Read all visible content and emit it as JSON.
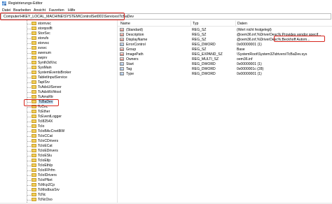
{
  "window": {
    "title": "Registrierungs-Editor",
    "icon": "regedit-icon"
  },
  "menu": [
    "Datei",
    "Bearbeiten",
    "Ansicht",
    "Favoriten",
    "Hilfe"
  ],
  "address": "Computer\\HKEY_LOCAL_MACHINE\\SYSTEM\\ControlSet001\\Services\\TcBaDev",
  "tree": {
    "items": [
      {
        "label": "stornvsc"
      },
      {
        "label": "storqosflt"
      },
      {
        "label": "StorSvc"
      },
      {
        "label": "storufs"
      },
      {
        "label": "storvsc"
      },
      {
        "label": "svsvc"
      },
      {
        "label": "swenum"
      },
      {
        "label": "swprv"
      },
      {
        "label": "Synth3dVsc"
      },
      {
        "label": "SysMain"
      },
      {
        "label": "SystemEventsBroker"
      },
      {
        "label": "TabletInputService"
      },
      {
        "label": "TapiSrv"
      },
      {
        "label": "TcAdsUiServer"
      },
      {
        "label": "TcAdsWcfHost"
      },
      {
        "label": "TcAmsRtr"
      },
      {
        "label": "TcBaDev",
        "selected": true
      },
      {
        "label": "TcCnc"
      },
      {
        "label": "TcEther"
      },
      {
        "label": "TcEventLogger"
      },
      {
        "label": "TcI8254X"
      },
      {
        "label": "TcIo"
      },
      {
        "label": "TcIoBAcCnet8iW"
      },
      {
        "label": "TcIoCCat"
      },
      {
        "label": "TcIoCDrivers"
      },
      {
        "label": "TcIoECat"
      },
      {
        "label": "TcIoEDrivers"
      },
      {
        "label": "TcIoESlu"
      },
      {
        "label": "TcIoEtlp"
      },
      {
        "label": "TcIoEthIp"
      },
      {
        "label": "TcIoIFPrfm"
      },
      {
        "label": "TcIoIDrivers"
      },
      {
        "label": "TcIoPNet"
      },
      {
        "label": "TcMcp2Cp"
      },
      {
        "label": "TcModbusSrv"
      },
      {
        "label": "TcNc"
      },
      {
        "label": "TcNcOso"
      }
    ]
  },
  "columns": {
    "name": "Name",
    "type": "Typ",
    "data": "Daten"
  },
  "values": [
    {
      "name": "(Standard)",
      "type": "REG_SZ",
      "data": "(Wert nicht festgelegt)",
      "kind": "ab"
    },
    {
      "name": "Description",
      "type": "REG_SZ",
      "data": "@oem36.inf,%DriverDesc%;Provides vendor specif...",
      "kind": "ab"
    },
    {
      "name": "DisplayName",
      "type": "REG_SZ",
      "data": "@oem36.inf,%DriverDesc%;Beckhoff Autom...",
      "kind": "ab"
    },
    {
      "name": "ErrorControl",
      "type": "REG_DWORD",
      "data": "0x00000001 (1)",
      "kind": "bin"
    },
    {
      "name": "Group",
      "type": "REG_SZ",
      "data": "Base",
      "kind": "ab"
    },
    {
      "name": "ImagePath",
      "type": "REG_EXPAND_SZ",
      "data": "\\SystemRoot\\System32\\drivers\\TcBaDev.sys",
      "kind": "ab"
    },
    {
      "name": "Owners",
      "type": "REG_MULTI_SZ",
      "data": "oem36.inf",
      "kind": "ab"
    },
    {
      "name": "Start",
      "type": "REG_DWORD",
      "data": "0x00000001 (1)",
      "kind": "bin"
    },
    {
      "name": "Tag",
      "type": "REG_DWORD",
      "data": "0x0000001c (28)",
      "kind": "bin"
    },
    {
      "name": "Type",
      "type": "REG_DWORD",
      "data": "0x00000001 (1)",
      "kind": "bin"
    }
  ],
  "highlight_color": "#d7261e"
}
